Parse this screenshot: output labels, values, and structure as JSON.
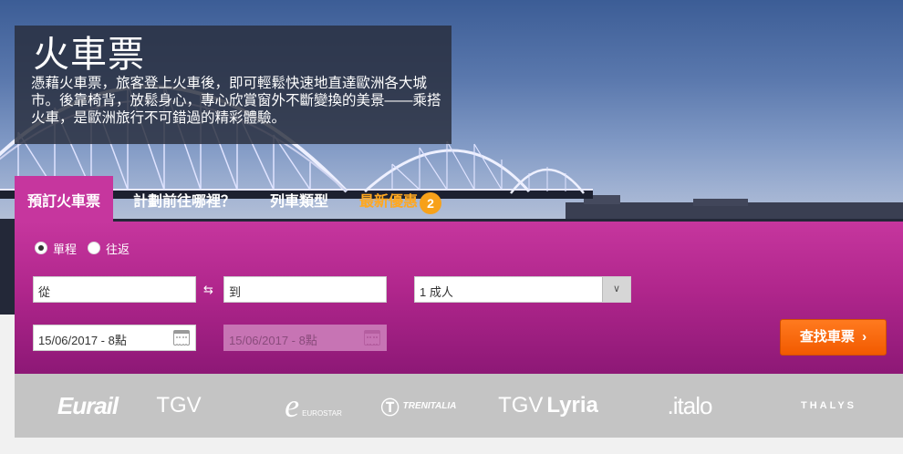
{
  "hero": {
    "title": "火車票",
    "description": "憑藉火車票，旅客登上火車後，即可輕鬆快速地直達歐洲各大城市。後靠椅背，放鬆身心，專心欣賞窗外不斷變換的美景——乘搭火車，是歐洲旅行不可錯過的精彩體驗。"
  },
  "tabs": [
    {
      "label": "預訂火車票",
      "active": true
    },
    {
      "label": "計劃前往哪裡？",
      "active": false
    },
    {
      "label": "列車類型",
      "active": false
    },
    {
      "label": "最新優惠",
      "active": false
    }
  ],
  "deals_badge": "2",
  "trip_type": {
    "options": [
      "單程",
      "往返"
    ],
    "selected": "單程"
  },
  "form": {
    "from_placeholder": "從",
    "to_placeholder": "到",
    "passengers": "1 成人",
    "depart_date": "15/06/2017 - 8點",
    "return_date": "15/06/2017 - 8點",
    "search_label": "查找車票"
  },
  "logos": [
    {
      "name": "Eurail",
      "text": "Eurail"
    },
    {
      "name": "TGV",
      "text": "TGV"
    },
    {
      "name": "Eurostar",
      "text": "EUROSTAR"
    },
    {
      "name": "Trenitalia",
      "text": "TRENITALIA"
    },
    {
      "name": "TGV Lyria",
      "text_a": "TGV",
      "text_b": "Lyria"
    },
    {
      "name": "Italo",
      "text": ".italo"
    },
    {
      "name": "Thalys",
      "text": "THALYS"
    }
  ],
  "colors": {
    "panel": "#c6369e",
    "button": "#f25a00",
    "badge": "#f7a11a",
    "deals_tab": "#ffa820"
  }
}
